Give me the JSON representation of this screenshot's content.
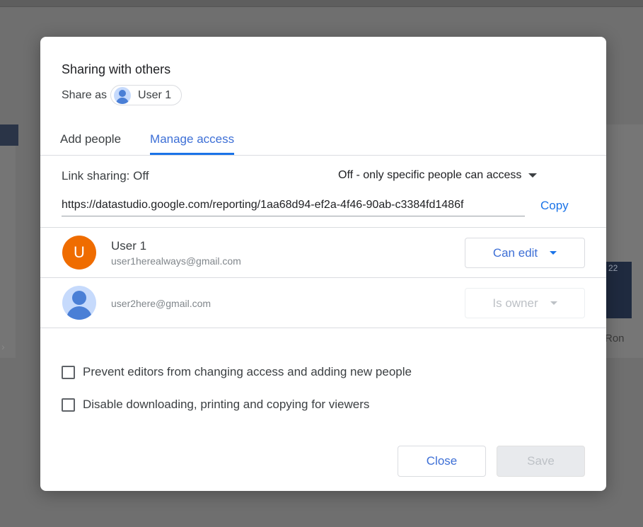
{
  "dialog": {
    "title": "Sharing with others",
    "share_as_label": "Share as",
    "share_as_user": "User 1"
  },
  "tabs": [
    {
      "label": "Add people",
      "active": false
    },
    {
      "label": "Manage access",
      "active": true
    }
  ],
  "link_sharing": {
    "label": "Link sharing: Off",
    "dropdown_value": "Off - only specific people can access",
    "url": "https://datastudio.google.com/reporting/1aa68d94-ef2a-4f46-90ab-c3384fd1486f",
    "copy_label": "Copy"
  },
  "people": [
    {
      "name": "User 1",
      "email": "user1herealways@gmail.com",
      "avatar_letter": "U",
      "avatar_color": "#ef6c00",
      "role": "Can edit",
      "role_enabled": true
    },
    {
      "name": "",
      "email": "user2here@gmail.com",
      "avatar_letter": "",
      "avatar_icon": "person-icon",
      "role": "Is owner",
      "role_enabled": false
    }
  ],
  "options": [
    {
      "label": "Prevent editors from changing access and adding new people",
      "checked": false
    },
    {
      "label": "Disable downloading, printing and copying for viewers",
      "checked": false
    }
  ],
  "buttons": {
    "close_label": "Close",
    "save_label": "Save"
  },
  "background": {
    "chart_number": "22",
    "chart_label": "Ron"
  },
  "colors": {
    "accent": "#1a73e8",
    "overlay": "#6f6f6f"
  }
}
